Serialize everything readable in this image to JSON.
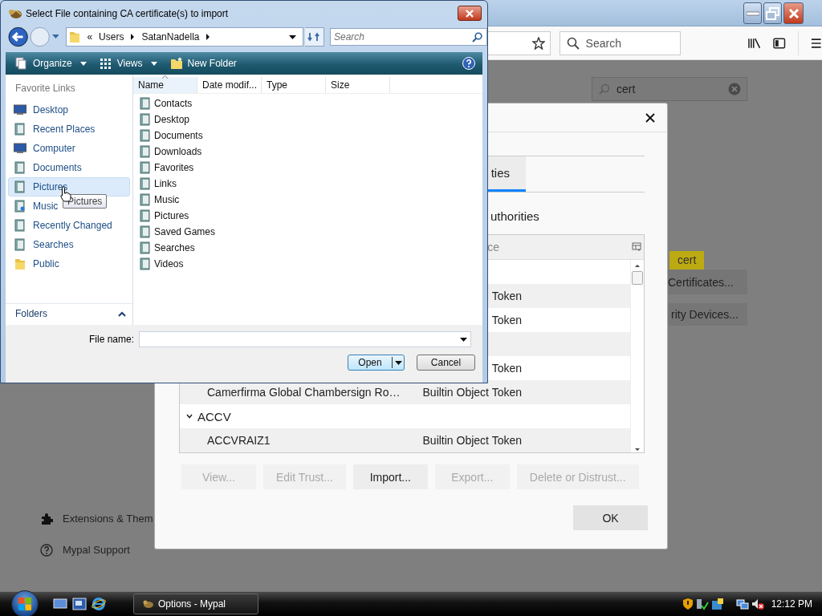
{
  "browser": {
    "search": {
      "placeholder": "Search"
    },
    "find": {
      "value": "cert"
    },
    "highlight": "cert",
    "buttons": [
      "Certificates...",
      "rity Devices..."
    ],
    "links": [
      "Extensions & Them",
      "Mypal Support"
    ]
  },
  "cert_dialog": {
    "tab": {
      "label": "ties",
      "selected": true
    },
    "heading": "uthorities",
    "column": "ce",
    "groups": [
      {
        "children": [
          {
            "device": "Token"
          },
          {
            "device": "Token"
          }
        ]
      },
      {
        "children": [
          {
            "device": "Token"
          },
          {
            "name": "Camerfirma Global Chambersign Ro…",
            "device": "Builtin Object Token"
          }
        ]
      },
      {
        "name": "ACCV",
        "expanded": true,
        "children": [
          {
            "name": "ACCVRAIZ1",
            "device": "Builtin Object Token"
          }
        ]
      }
    ],
    "buttons": [
      {
        "label": "View...",
        "disabled": true
      },
      {
        "label": "Edit Trust...",
        "disabled": true
      },
      {
        "label": "Import...",
        "disabled": false
      },
      {
        "label": "Export...",
        "disabled": true
      },
      {
        "label": "Delete or Distrust...",
        "disabled": true
      }
    ],
    "ok": "OK"
  },
  "file_dialog": {
    "title": "Select File containing CA certificate(s) to import",
    "address": [
      "«",
      "Users",
      "SatanNadella"
    ],
    "search": {
      "placeholder": "Search"
    },
    "toolbar": [
      {
        "label": "Organize",
        "kind": "menu"
      },
      {
        "label": "Views",
        "kind": "menu"
      },
      {
        "label": "New Folder",
        "kind": "button"
      }
    ],
    "favorite_links": {
      "heading": "Favorite Links",
      "items": [
        {
          "label": "Desktop",
          "selected": false
        },
        {
          "label": "Recent Places",
          "selected": false
        },
        {
          "label": "Computer",
          "selected": false
        },
        {
          "label": "Documents",
          "selected": false
        },
        {
          "label": "Pictures",
          "selected": true
        },
        {
          "label": "Music",
          "selected": false
        },
        {
          "label": "Recently Changed",
          "selected": false
        },
        {
          "label": "Searches",
          "selected": false
        },
        {
          "label": "Public",
          "selected": false
        }
      ]
    },
    "folders_label": "Folders",
    "columns": [
      "Name",
      "Date modif...",
      "Type",
      "Size"
    ],
    "files": [
      "Contacts",
      "Desktop",
      "Documents",
      "Downloads",
      "Favorites",
      "Links",
      "Music",
      "Pictures",
      "Saved Games",
      "Searches",
      "Videos"
    ],
    "file_name": {
      "label": "File name:"
    },
    "buttons": [
      {
        "label": "Open",
        "kind": "split"
      },
      {
        "label": "Cancel",
        "kind": "plain"
      }
    ],
    "tooltip": "Pictures"
  },
  "taskbar": {
    "task": "Options - Mypal",
    "clock": "12:12 PM"
  }
}
